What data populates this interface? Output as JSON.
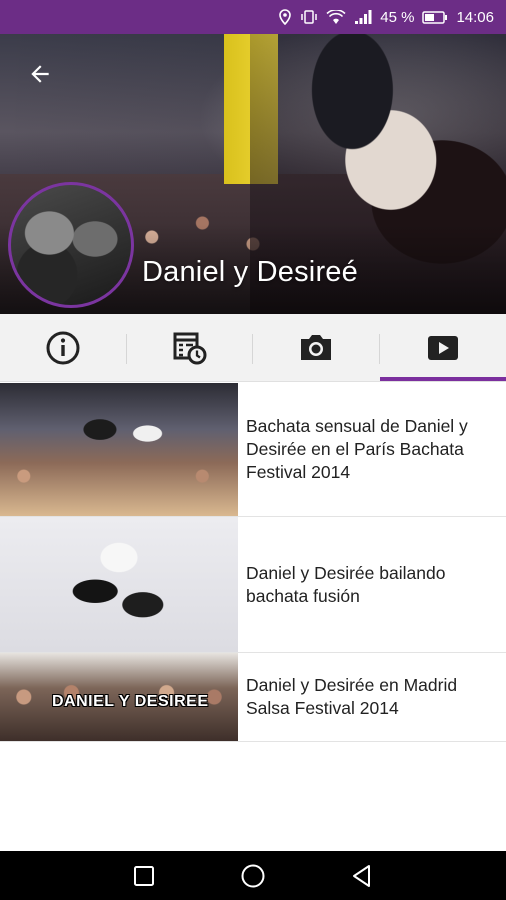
{
  "status_bar": {
    "battery_percent": "45 %",
    "time": "14:06",
    "icons": [
      "location-icon",
      "vibrate-icon",
      "wifi-icon",
      "signal-icon",
      "battery-icon"
    ]
  },
  "header": {
    "title": "Daniel y Desireé",
    "back_icon": "arrow-left-icon"
  },
  "tabs": [
    {
      "icon": "info-icon",
      "active": false
    },
    {
      "icon": "schedule-icon",
      "active": false
    },
    {
      "icon": "camera-icon",
      "active": false
    },
    {
      "icon": "video-play-icon",
      "active": true
    }
  ],
  "videos": [
    {
      "title": "Bachata sensual de Daniel y Desirée en el París Bachata Festival 2014"
    },
    {
      "title": "Daniel y Desirée bailando bachata fusión"
    },
    {
      "title": "Daniel y Desirée en Madrid Salsa Festival 2014",
      "thumb_text": "DANIEL Y DESIREE"
    }
  ],
  "nav": {
    "icons": [
      "recents-square-icon",
      "home-circle-icon",
      "back-triangle-icon"
    ]
  },
  "colors": {
    "status_bar": "#6c2d86",
    "accent": "#7b2f9e",
    "tab_bar": "#f2f2f2",
    "nav_bar": "#000000"
  }
}
